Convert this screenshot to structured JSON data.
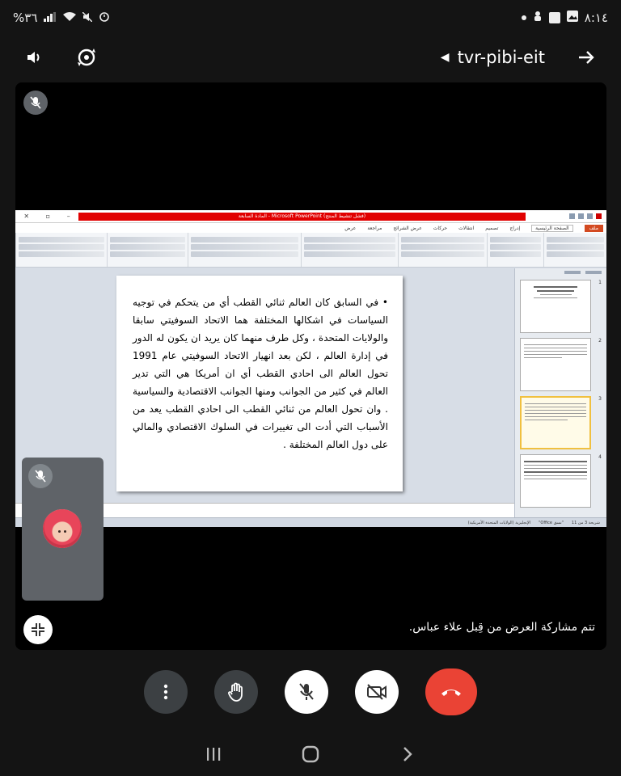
{
  "status_bar": {
    "battery": "%٣٦",
    "time": "٨:١٤"
  },
  "header": {
    "meeting_code": "tvr-pibi-eit",
    "speaker_icon": "speaker-icon",
    "switch_camera_icon": "switch-camera-icon",
    "back_icon": "arrow-right-icon"
  },
  "shared_screen": {
    "app_title": "المادة السابعة - Microsoft PowerPoint (فشل تنشيط المنتج)",
    "ribbon_tabs": [
      "ملف",
      "الصفحة الرئيسية",
      "إدراج",
      "تصميم",
      "انتقالات",
      "حركات",
      "عرض الشرائح",
      "مراجعة",
      "عرض"
    ],
    "slide_text": "• في السابق كان العالم ثنائي القطب أي من يتحكم في توجيه السياسات في اشكالها المختلفة هما الاتحاد السوفيتي سابقا والولايات المتحدة ، وكل طرف منهما كان يريد ان يكون له الدور في إدارة العالم ، لكن بعد انهيار الاتحاد السوفيتي عام 1991 تحول العالم الى احادي القطب أي ان أمريكا هي التي تدير العالم في كثير من الجوانب ومنها الجوانب الاقتصادية والسياسية . وان تحول العالم من ثنائي القطب الى احادي القطب يعد من الأسباب التي أدت الى تغييرات في السلوك الاقتصادي والمالي على دول العالم المختلفة .",
    "thumbnail_numbers": [
      "1",
      "2",
      "3",
      "4"
    ],
    "status_text": "شريحة 3 من 11",
    "theme_text": "\"Office نسق\"",
    "language_text": "الإنجليزية (الولايات المتحدة الأمريكية)"
  },
  "presenting_label": "تتم مشاركة العرض من قِبل علاء عباس.",
  "controls": {
    "more_icon": "more-vert-icon",
    "raise_hand_icon": "hand-icon",
    "mic_icon": "mic-off-icon",
    "camera_icon": "videocam-off-icon",
    "end_call_icon": "end-call-icon"
  },
  "colors": {
    "end_call": "#ea4335",
    "dark_button": "#3c4043",
    "stage_bg": "#000000"
  }
}
